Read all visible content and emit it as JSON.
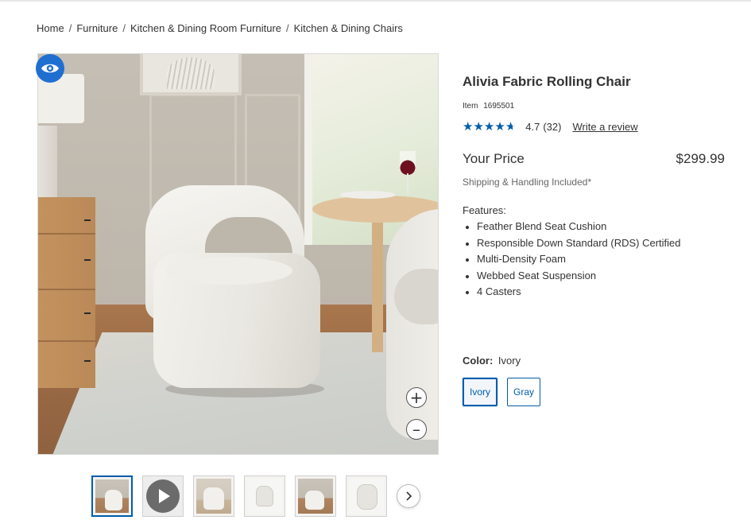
{
  "breadcrumb": {
    "items": [
      "Home",
      "Furniture",
      "Kitchen & Dining Room Furniture",
      "Kitchen & Dining Chairs"
    ],
    "separator": "/"
  },
  "gallery": {
    "badge_icon": "eye-icon",
    "zoom_in_symbol": "+",
    "zoom_out_symbol": "–",
    "thumbnails": [
      {
        "kind": "image",
        "active": true
      },
      {
        "kind": "video",
        "active": false
      },
      {
        "kind": "image",
        "active": false
      },
      {
        "kind": "image",
        "active": false
      },
      {
        "kind": "image",
        "active": false
      },
      {
        "kind": "image",
        "active": false
      }
    ],
    "next_icon": "chevron-right-icon"
  },
  "product": {
    "title": "Alivia Fabric Rolling Chair",
    "item_label": "Item",
    "item_number": "1695501",
    "rating": {
      "value": "4.7",
      "count": "(32)",
      "stars_filled": 4.7,
      "write_review": "Write a review"
    },
    "price_label": "Your Price",
    "price": "$299.99",
    "shipping": "Shipping & Handling Included*",
    "features_heading": "Features:",
    "features": [
      "Feather Blend Seat Cushion",
      "Responsible Down Standard (RDS) Certified",
      "Multi-Density Foam",
      "Webbed Seat Suspension",
      "4 Casters"
    ],
    "color_label": "Color:",
    "color_value": "Ivory",
    "color_options": [
      "Ivory",
      "Gray"
    ],
    "selected_color": "Ivory"
  },
  "colors": {
    "accent": "#005dab",
    "badge": "#1f6fd0"
  }
}
